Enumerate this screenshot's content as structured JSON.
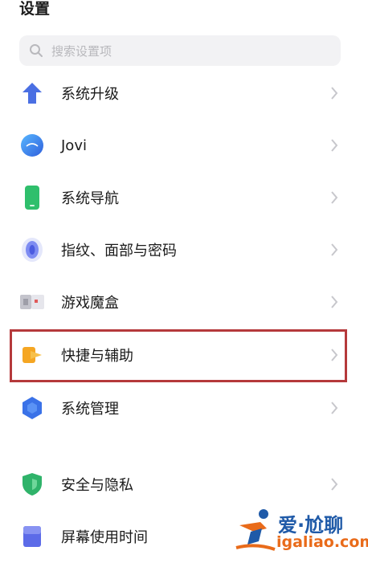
{
  "header": {
    "title": "设置"
  },
  "search": {
    "placeholder": "搜索设置项",
    "icon": "search-icon"
  },
  "settings_items": [
    {
      "label": "系统升级",
      "icon": "system-upgrade-arrow-icon",
      "color": "#4a6fe3"
    },
    {
      "label": "Jovi",
      "icon": "jovi-icon",
      "color": "#3d7fe8"
    },
    {
      "label": "系统导航",
      "icon": "phone-navigation-icon",
      "color": "#2fbf6c"
    },
    {
      "label": "指纹、面部与密码",
      "icon": "fingerprint-icon",
      "color": "#5f6ff0"
    },
    {
      "label": "游戏魔盒",
      "icon": "game-box-icon",
      "color": "#9a9aa4"
    },
    {
      "label": "快捷与辅助",
      "icon": "shortcut-assist-icon",
      "color": "#f5a623"
    },
    {
      "label": "系统管理",
      "icon": "system-management-hexagon-icon",
      "color": "#3a72e8"
    },
    {
      "label": "安全与隐私",
      "icon": "security-shield-icon",
      "color": "#2fb36a"
    },
    {
      "label": "屏幕使用时间",
      "icon": "screen-time-icon",
      "color": "#5c6be8"
    }
  ],
  "highlighted_item": "快捷与辅助",
  "watermark": {
    "chinese": "爱·尬聊",
    "url": "igaliao.com"
  }
}
